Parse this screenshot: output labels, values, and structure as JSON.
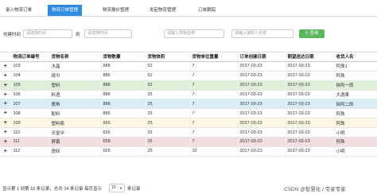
{
  "tabs": [
    {
      "label": "录入物流订单",
      "active": false
    },
    {
      "label": "物流订单管理",
      "active": true
    },
    {
      "label": "物流报价管理",
      "active": false
    },
    {
      "label": "发起物流管理",
      "active": false
    },
    {
      "label": "订单跟踪",
      "active": false
    }
  ],
  "filters": {
    "date_label": "创建时间",
    "date_from_placeholder": "请选择时间",
    "date_sep": "到",
    "date_to_placeholder": "请选择时间",
    "goods_placeholder": "请输入货物名称",
    "receiver_placeholder": "请输入接收人名称",
    "search_label": "查询",
    "search_icon": "magnifier-icon"
  },
  "table": {
    "columns": [
      "",
      "物流订单编号",
      "货物名称",
      "货物数量",
      "货物体积",
      "货物单位重量",
      "订单创建日期",
      "期望送达日期",
      "收货人名"
    ],
    "rows": [
      {
        "id": "103",
        "goods": "水晶",
        "qty": "888",
        "vol": "52",
        "weight": "7",
        "created": "2017-03-23",
        "expected": "2017-03-23",
        "receiver": "阿珠1",
        "style": "plain"
      },
      {
        "id": "104",
        "goods": "纸巾",
        "qty": "885",
        "vol": "52",
        "weight": "7",
        "created": "2017-03-23",
        "expected": "2017-03-23",
        "receiver": "阿珠",
        "style": "plain"
      },
      {
        "id": "105",
        "goods": "塑料",
        "qty": "888",
        "vol": "52",
        "weight": "7",
        "created": "2017-03-23",
        "expected": "2017-03-23",
        "receiver": "徐阿一即",
        "style": "green"
      },
      {
        "id": "106",
        "goods": "料酒",
        "qty": "888",
        "vol": "25",
        "weight": "7",
        "created": "2017-03-23",
        "expected": "2017-03-23",
        "receiver": "大酒果",
        "style": "plain"
      },
      {
        "id": "107",
        "goods": "鹿角",
        "qty": "888",
        "vol": "25",
        "weight": "7",
        "created": "2017-03-23",
        "expected": "2017-03-23",
        "receiver": "徐阿二即",
        "style": "blue"
      },
      {
        "id": "108",
        "goods": "配料",
        "qty": "885",
        "vol": "25",
        "weight": "7",
        "created": "2017-03-23",
        "expected": "2017-03-23",
        "receiver": "阿珠",
        "style": "plain"
      },
      {
        "id": "109",
        "goods": "塑料瓶",
        "qty": "665",
        "vol": "25",
        "weight": "7",
        "created": "2017-03-23",
        "expected": "2017-03-23",
        "receiver": "阿珠",
        "style": "yellow"
      },
      {
        "id": "110",
        "goods": "天堂伞",
        "qty": "655",
        "vol": "25",
        "weight": "7",
        "created": "2017-03-23",
        "expected": "2017-03-23",
        "receiver": "小明",
        "style": "plain"
      },
      {
        "id": "111",
        "goods": "屏幕",
        "qty": "658",
        "vol": "25",
        "weight": "7",
        "created": "2017-03-23",
        "expected": "2017-03-23",
        "receiver": "阿珠",
        "style": "red"
      },
      {
        "id": "112",
        "goods": "瓷砖",
        "qty": "655",
        "vol": "25",
        "weight": "10",
        "created": "2017-03-23",
        "expected": "2017-03-23",
        "receiver": "小明",
        "style": "plain"
      }
    ]
  },
  "footer": {
    "summary": "显示第 1 到第 10 条记录，总共 14 条记录 每页显示",
    "page_size": "10",
    "suffix": "条记录",
    "watermark": "CSDN @智慧化 / 专家专家"
  },
  "colors": {
    "tab_active": "#2d8ce2",
    "search_button": "#5cb85c",
    "row_green": "#dff0d8",
    "row_blue": "#d9edf7",
    "row_yellow": "#fcf8e3",
    "row_red": "#f2dede"
  }
}
